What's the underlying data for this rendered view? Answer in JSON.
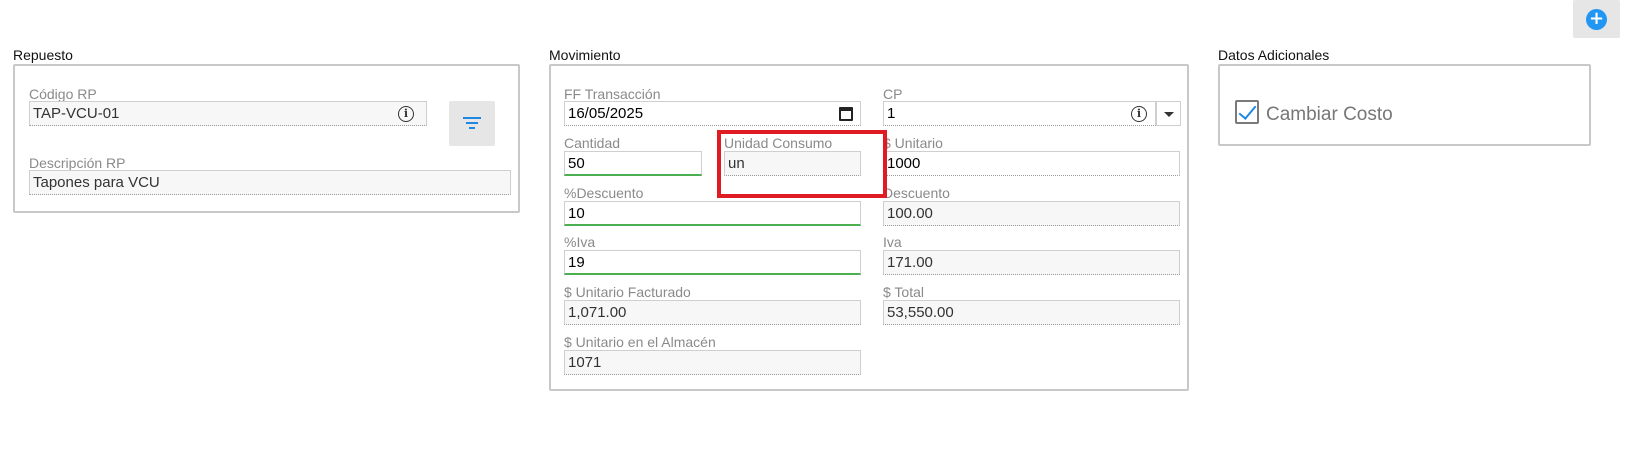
{
  "toolbar": {
    "add_icon": "plus-circle-icon",
    "add_symbol": "+"
  },
  "repuesto": {
    "title": "Repuesto",
    "codigo_label": "Código RP",
    "codigo_value": "TAP-VCU-01",
    "descripcion_label": "Descripción RP",
    "descripcion_value": "Tapones para VCU",
    "info_symbol": "i"
  },
  "movimiento": {
    "title": "Movimiento",
    "ff_transaccion_label": "FF Transacción",
    "ff_transaccion_value": "16/05/2025",
    "cp_label": "CP",
    "cp_value": "1",
    "info_symbol": "i",
    "cantidad_label": "Cantidad",
    "cantidad_value": "50",
    "unidad_consumo_label": "Unidad Consumo",
    "unidad_consumo_value": "un",
    "unitario_label": "$ Unitario",
    "unitario_value": "1000",
    "pct_descuento_label": "%Descuento",
    "pct_descuento_value": "10",
    "descuento_label": "Descuento",
    "descuento_value": "100.00",
    "pct_iva_label": "%Iva",
    "pct_iva_value": "19",
    "iva_label": "Iva",
    "iva_value": "171.00",
    "unitario_facturado_label": "$ Unitario Facturado",
    "unitario_facturado_value": "1,071.00",
    "total_label": "$ Total",
    "total_value": "53,550.00",
    "unitario_almacen_label": "$ Unitario en el Almacén",
    "unitario_almacen_value": "1071"
  },
  "datos_adicionales": {
    "title": "Datos Adicionales",
    "cambiar_costo_label": "Cambiar Costo",
    "cambiar_costo_checked": true
  },
  "colors": {
    "accent": "#2196f3",
    "valid": "#4caf50",
    "highlight": "#e01b24"
  }
}
